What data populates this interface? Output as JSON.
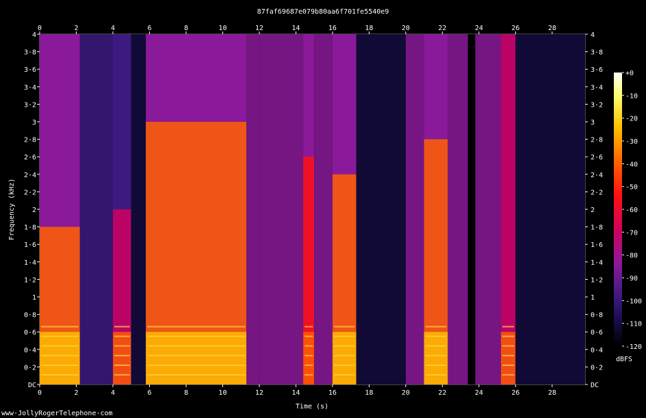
{
  "chart_data": {
    "type": "heatmap",
    "title": "87faf69687e079b80aa6f701fe5540e9",
    "xlabel": "Time (s)",
    "ylabel": "Frequency (kHz)",
    "xlim": [
      0,
      29.8
    ],
    "ylim": [
      0,
      4
    ],
    "x_ticks": [
      0,
      2,
      4,
      6,
      8,
      10,
      12,
      14,
      16,
      18,
      20,
      22,
      24,
      26,
      28
    ],
    "x_tick_labels": [
      "0",
      "2",
      "4",
      "6",
      "8",
      "10",
      "12",
      "14",
      "16",
      "18",
      "20",
      "22",
      "24",
      "26",
      "28"
    ],
    "y_ticks": [
      0,
      0.2,
      0.4,
      0.6,
      0.8,
      1,
      1.2,
      1.4,
      1.6,
      1.8,
      2,
      2.2,
      2.4,
      2.6,
      2.8,
      3,
      3.2,
      3.4,
      3.6,
      3.8,
      4
    ],
    "y_tick_labels": [
      "DC",
      "0·2",
      "0·4",
      "0·6",
      "0·8",
      "1",
      "1·2",
      "1·4",
      "1·6",
      "1·8",
      "2",
      "2·2",
      "2·4",
      "2·6",
      "2·8",
      "3",
      "3·2",
      "3·4",
      "3·6",
      "3·8",
      "4"
    ],
    "colorbar": {
      "label": "dBFS",
      "range": [
        -120,
        0
      ],
      "ticks": [
        0,
        -10,
        -20,
        -30,
        -40,
        -50,
        -60,
        -70,
        -80,
        -90,
        -100,
        -110,
        -120
      ],
      "tick_labels": [
        "+0",
        "-10",
        "-20",
        "-30",
        "-40",
        "-50",
        "-60",
        "-70",
        "-80",
        "-90",
        "-100",
        "-110",
        "-120"
      ],
      "colormap": [
        "#ffffff",
        "#ffff60",
        "#ffc000",
        "#ff6000",
        "#ff1010",
        "#d00060",
        "#8a1a9a",
        "#3c1a80",
        "#140a40",
        "#000000"
      ]
    },
    "segments": [
      {
        "t0": 0.0,
        "t1": 2.2,
        "level_db": -45,
        "top_khz": 1.8,
        "voiced": true
      },
      {
        "t0": 2.2,
        "t1": 4.0,
        "level_db": -95,
        "top_khz": 4.0,
        "voiced": false
      },
      {
        "t0": 4.0,
        "t1": 5.0,
        "level_db": -60,
        "top_khz": 2.0,
        "voiced": true
      },
      {
        "t0": 5.0,
        "t1": 5.8,
        "level_db": -100,
        "top_khz": 4.0,
        "voiced": false
      },
      {
        "t0": 5.8,
        "t1": 11.3,
        "level_db": -45,
        "top_khz": 3.0,
        "voiced": true
      },
      {
        "t0": 11.3,
        "t1": 12.0,
        "level_db": -85,
        "top_khz": 4.0,
        "voiced": false
      },
      {
        "t0": 12.0,
        "t1": 14.4,
        "level_db": -80,
        "top_khz": 4.0,
        "voiced": false
      },
      {
        "t0": 14.4,
        "t1": 15.0,
        "level_db": -50,
        "top_khz": 2.6,
        "voiced": true
      },
      {
        "t0": 15.0,
        "t1": 16.0,
        "level_db": -85,
        "top_khz": 4.0,
        "voiced": false
      },
      {
        "t0": 16.0,
        "t1": 17.3,
        "level_db": -45,
        "top_khz": 2.4,
        "voiced": true
      },
      {
        "t0": 17.3,
        "t1": 20.0,
        "level_db": -100,
        "top_khz": 4.0,
        "voiced": false
      },
      {
        "t0": 20.0,
        "t1": 21.0,
        "level_db": -85,
        "top_khz": 4.0,
        "voiced": false
      },
      {
        "t0": 21.0,
        "t1": 22.3,
        "level_db": -45,
        "top_khz": 2.8,
        "voiced": true
      },
      {
        "t0": 22.3,
        "t1": 23.4,
        "level_db": -80,
        "top_khz": 4.0,
        "voiced": false
      },
      {
        "t0": 23.4,
        "t1": 23.8,
        "level_db": -120,
        "top_khz": 4.0,
        "voiced": false
      },
      {
        "t0": 23.8,
        "t1": 25.2,
        "level_db": -85,
        "top_khz": 4.0,
        "voiced": false
      },
      {
        "t0": 25.2,
        "t1": 26.0,
        "level_db": -60,
        "top_khz": 4.0,
        "voiced": true
      },
      {
        "t0": 26.0,
        "t1": 29.8,
        "level_db": -105,
        "top_khz": 4.0,
        "voiced": false
      }
    ]
  },
  "footer": {
    "watermark": "www·JollyRogerTelephone·com"
  }
}
